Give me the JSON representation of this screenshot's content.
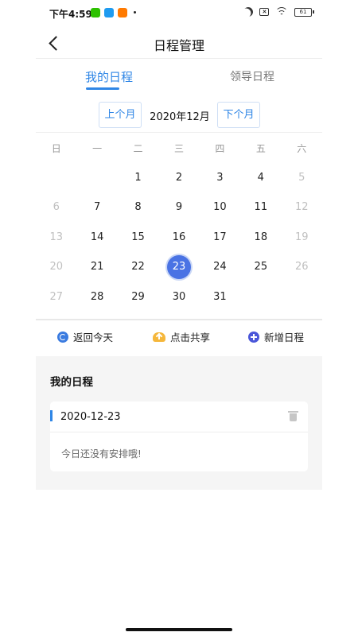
{
  "status_bar": {
    "time": "下午4:59",
    "battery": "61"
  },
  "header": {
    "title": "日程管理"
  },
  "tabs": [
    {
      "label": "我的日程",
      "active": true
    },
    {
      "label": "领导日程",
      "active": false
    }
  ],
  "month_switcher": {
    "prev_label": "上个月",
    "current": "2020年12月",
    "next_label": "下个月"
  },
  "calendar": {
    "weekdays": [
      "日",
      "一",
      "二",
      "三",
      "四",
      "五",
      "六"
    ],
    "weeks": [
      [
        {
          "d": "",
          "m": false
        },
        {
          "d": "",
          "m": false
        },
        {
          "d": "1",
          "m": false
        },
        {
          "d": "2",
          "m": false
        },
        {
          "d": "3",
          "m": false
        },
        {
          "d": "4",
          "m": false
        },
        {
          "d": "5",
          "m": true
        }
      ],
      [
        {
          "d": "6",
          "m": true
        },
        {
          "d": "7",
          "m": false
        },
        {
          "d": "8",
          "m": false
        },
        {
          "d": "9",
          "m": false
        },
        {
          "d": "10",
          "m": false
        },
        {
          "d": "11",
          "m": false
        },
        {
          "d": "12",
          "m": true
        }
      ],
      [
        {
          "d": "13",
          "m": true
        },
        {
          "d": "14",
          "m": false
        },
        {
          "d": "15",
          "m": false
        },
        {
          "d": "16",
          "m": false
        },
        {
          "d": "17",
          "m": false
        },
        {
          "d": "18",
          "m": false
        },
        {
          "d": "19",
          "m": true
        }
      ],
      [
        {
          "d": "20",
          "m": true
        },
        {
          "d": "21",
          "m": false
        },
        {
          "d": "22",
          "m": false
        },
        {
          "d": "23",
          "m": false,
          "selected": true
        },
        {
          "d": "24",
          "m": false
        },
        {
          "d": "25",
          "m": false
        },
        {
          "d": "26",
          "m": true
        }
      ],
      [
        {
          "d": "27",
          "m": true
        },
        {
          "d": "28",
          "m": false
        },
        {
          "d": "29",
          "m": false
        },
        {
          "d": "30",
          "m": false
        },
        {
          "d": "31",
          "m": false
        },
        {
          "d": "",
          "m": false
        },
        {
          "d": "",
          "m": false
        }
      ]
    ],
    "selected_color": "#4a73e4"
  },
  "actions": {
    "today_label": "返回今天",
    "share_label": "点击共享",
    "add_label": "新增日程"
  },
  "my_schedule": {
    "title": "我的日程",
    "date": "2020-12-23",
    "empty_text": "今日还没有安排哦!"
  },
  "colors": {
    "accent": "#2f86e6"
  }
}
